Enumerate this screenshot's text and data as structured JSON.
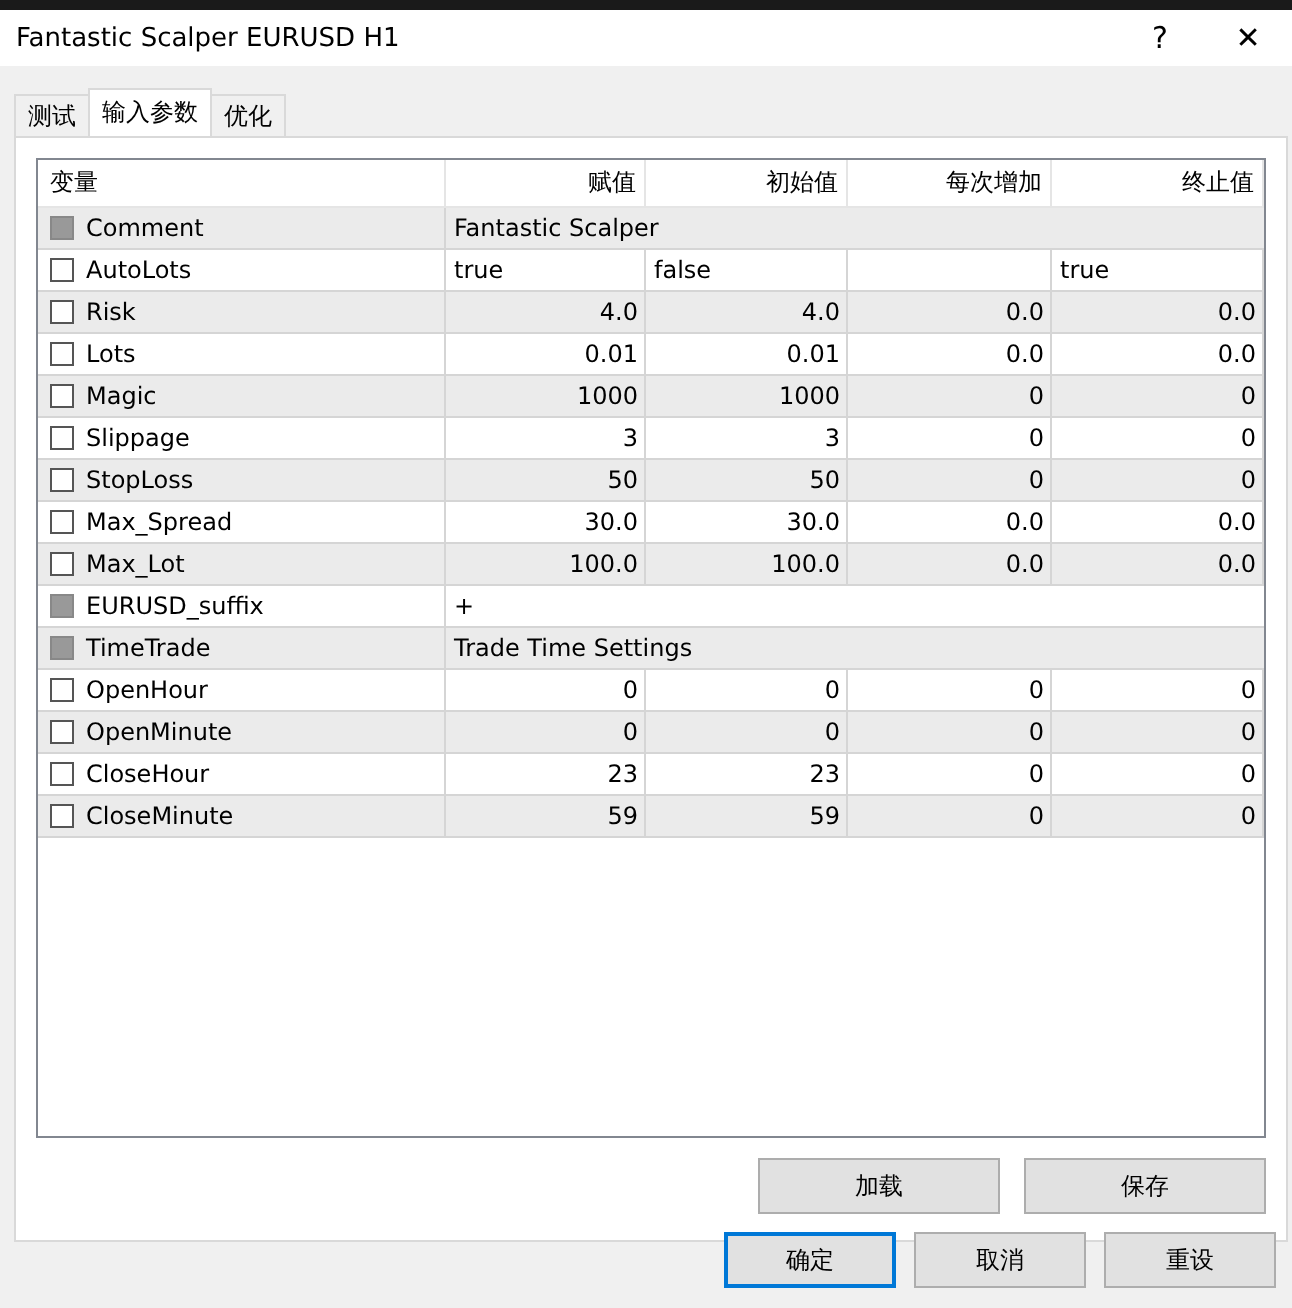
{
  "window": {
    "title": "Fantastic Scalper EURUSD H1",
    "help": "?",
    "close": "✕"
  },
  "tabs": [
    {
      "label": "测试",
      "selected": false
    },
    {
      "label": "输入参数",
      "selected": true
    },
    {
      "label": "优化",
      "selected": false
    }
  ],
  "table": {
    "columns": [
      "变量",
      "赋值",
      "初始值",
      "每次增加",
      "终止值"
    ],
    "rows": [
      {
        "kind": "text",
        "disabled": true,
        "name": "Comment",
        "value": "Fantastic Scalper"
      },
      {
        "kind": "flags",
        "disabled": false,
        "name": "AutoLots",
        "cells": [
          "true",
          "false",
          "",
          "true"
        ]
      },
      {
        "kind": "cells",
        "disabled": false,
        "name": "Risk",
        "cells": [
          "4.0",
          "4.0",
          "0.0",
          "0.0"
        ]
      },
      {
        "kind": "cells",
        "disabled": false,
        "name": "Lots",
        "cells": [
          "0.01",
          "0.01",
          "0.0",
          "0.0"
        ]
      },
      {
        "kind": "cells",
        "disabled": false,
        "name": "Magic",
        "cells": [
          "1000",
          "1000",
          "0",
          "0"
        ]
      },
      {
        "kind": "cells",
        "disabled": false,
        "name": "Slippage",
        "cells": [
          "3",
          "3",
          "0",
          "0"
        ]
      },
      {
        "kind": "cells",
        "disabled": false,
        "name": "StopLoss",
        "cells": [
          "50",
          "50",
          "0",
          "0"
        ]
      },
      {
        "kind": "cells",
        "disabled": false,
        "name": "Max_Spread",
        "cells": [
          "30.0",
          "30.0",
          "0.0",
          "0.0"
        ]
      },
      {
        "kind": "cells",
        "disabled": false,
        "name": "Max_Lot",
        "cells": [
          "100.0",
          "100.0",
          "0.0",
          "0.0"
        ]
      },
      {
        "kind": "text",
        "disabled": true,
        "name": "EURUSD_suffix",
        "value": "+"
      },
      {
        "kind": "text",
        "disabled": true,
        "name": "TimeTrade",
        "value": "Trade Time Settings"
      },
      {
        "kind": "cells",
        "disabled": false,
        "name": "OpenHour",
        "cells": [
          "0",
          "0",
          "0",
          "0"
        ]
      },
      {
        "kind": "cells",
        "disabled": false,
        "name": "OpenMinute",
        "cells": [
          "0",
          "0",
          "0",
          "0"
        ]
      },
      {
        "kind": "cells",
        "disabled": false,
        "name": "CloseHour",
        "cells": [
          "23",
          "23",
          "0",
          "0"
        ]
      },
      {
        "kind": "cells",
        "disabled": false,
        "name": "CloseMinute",
        "cells": [
          "59",
          "59",
          "0",
          "0"
        ]
      }
    ]
  },
  "panel_buttons": [
    "加载",
    "保存"
  ],
  "dialog_buttons": [
    {
      "label": "确定",
      "focused": true
    },
    {
      "label": "取消",
      "focused": false
    },
    {
      "label": "重设",
      "focused": false
    }
  ]
}
